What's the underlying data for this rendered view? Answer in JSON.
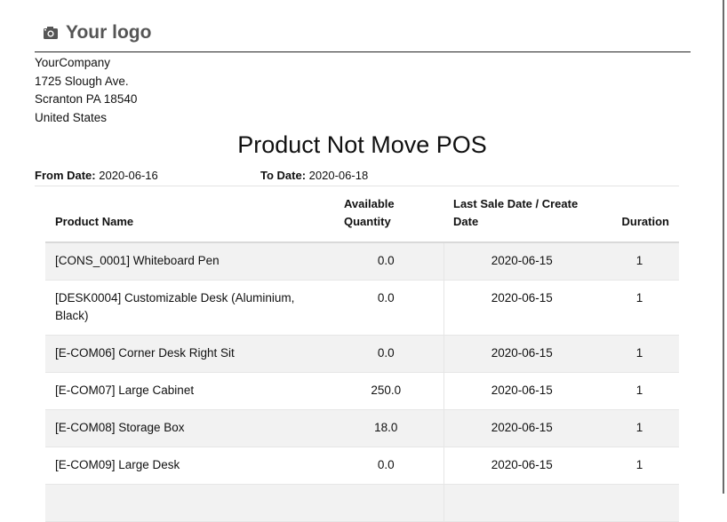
{
  "logo": {
    "text": "Your logo",
    "icon": "camera-icon"
  },
  "company": {
    "name": "YourCompany",
    "street": "1725 Slough Ave.",
    "city": "Scranton PA 18540",
    "country": "United States"
  },
  "report": {
    "title": "Product Not Move POS",
    "from_label": "From Date:",
    "from_value": "2020-06-16",
    "to_label": "To Date:",
    "to_value": "2020-06-18"
  },
  "table": {
    "headers": {
      "product": "Product Name",
      "qty_line1": "Available",
      "qty_line2": "Quantity",
      "date_line1": "Last Sale Date / Create",
      "date_line2": "Date",
      "duration": "Duration"
    },
    "rows": [
      {
        "product": "[CONS_0001] Whiteboard Pen",
        "qty": "0.0",
        "date": "2020-06-15",
        "duration": "1"
      },
      {
        "product": "[DESK0004] Customizable Desk (Aluminium, Black)",
        "qty": "0.0",
        "date": "2020-06-15",
        "duration": "1"
      },
      {
        "product": "[E-COM06] Corner Desk Right Sit",
        "qty": "0.0",
        "date": "2020-06-15",
        "duration": "1"
      },
      {
        "product": "[E-COM07] Large Cabinet",
        "qty": "250.0",
        "date": "2020-06-15",
        "duration": "1"
      },
      {
        "product": "[E-COM08] Storage Box",
        "qty": "18.0",
        "date": "2020-06-15",
        "duration": "1"
      },
      {
        "product": "[E-COM09] Large Desk",
        "qty": "0.0",
        "date": "2020-06-15",
        "duration": "1"
      }
    ]
  }
}
